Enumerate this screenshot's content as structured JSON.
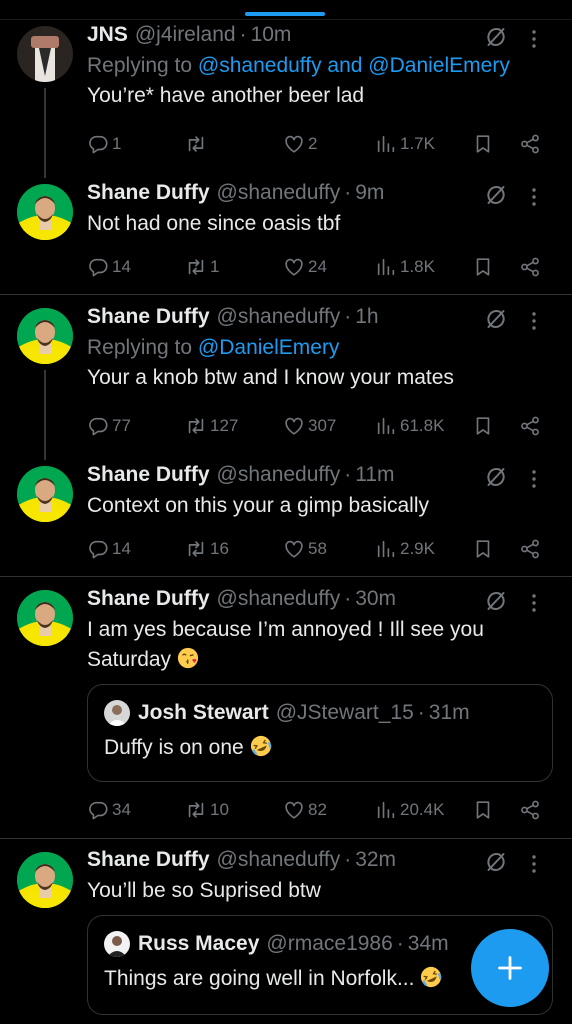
{
  "posts": [
    {
      "name": "JNS",
      "handle": "@j4ireland",
      "time": "10m",
      "replying_prefix": "Replying to ",
      "replying_links": "@shaneduffy and @DanielEmery",
      "text": "You’re* have another beer lad",
      "replies": "1",
      "reposts": "",
      "likes": "2",
      "views": "1.7K"
    },
    {
      "name": "Shane Duffy",
      "handle": "@shaneduffy",
      "time": "9m",
      "text": "Not had one since oasis tbf",
      "replies": "14",
      "reposts": "1",
      "likes": "24",
      "views": "1.8K"
    },
    {
      "name": "Shane Duffy",
      "handle": "@shaneduffy",
      "time": "1h",
      "replying_prefix": "Replying to ",
      "replying_links": "@DanielEmery",
      "text": "Your a knob btw and I know your mates",
      "replies": "77",
      "reposts": "127",
      "likes": "307",
      "views": "61.8K"
    },
    {
      "name": "Shane Duffy",
      "handle": "@shaneduffy",
      "time": "11m",
      "text": "Context on this your a gimp basically",
      "replies": "14",
      "reposts": "16",
      "likes": "58",
      "views": "2.9K"
    },
    {
      "name": "Shane Duffy",
      "handle": "@shaneduffy",
      "time": "30m",
      "text_line1": "I am yes because I’m annoyed ! Ill see you",
      "text_line2": "Saturday",
      "quote": {
        "name": "Josh Stewart",
        "handle": "@JStewart_15",
        "time": "31m",
        "text": "Duffy is on one"
      },
      "replies": "34",
      "reposts": "10",
      "likes": "82",
      "views": "20.4K"
    },
    {
      "name": "Shane Duffy",
      "handle": "@shaneduffy",
      "time": "32m",
      "text": "You’ll be so Suprised btw",
      "quote": {
        "name": "Russ Macey",
        "handle": "@rmace1986",
        "time": "34m",
        "text": "Things are going well in Norfolk..."
      }
    }
  ],
  "colors": {
    "accent": "#1d9bf0",
    "muted": "#71767b",
    "text": "#e7e9ea",
    "divider": "#2f3336",
    "kit_yellow": "#f5e400",
    "kit_green": "#00a650"
  },
  "icons": [
    "reply-icon",
    "repost-icon",
    "like-icon",
    "views-icon",
    "bookmark-icon",
    "share-icon",
    "grok-icon",
    "more-icon",
    "compose-plus-icon"
  ]
}
